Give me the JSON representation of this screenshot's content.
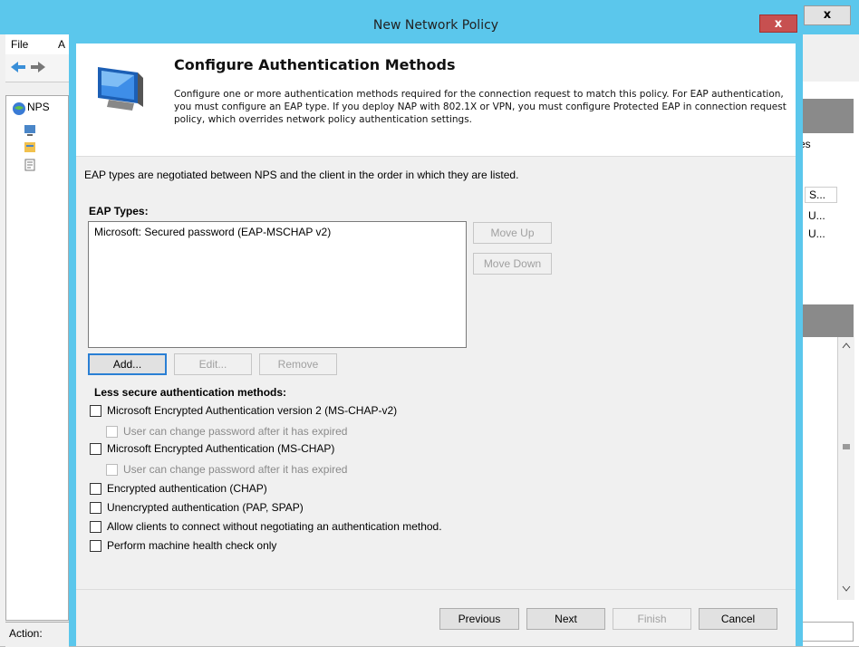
{
  "background_window": {
    "menu": [
      "File",
      "A"
    ],
    "tree_root": "NPS",
    "status_label": "Action:",
    "right_pane_text": "es",
    "right_pane_column": "S...",
    "right_pane_rows": [
      "U...",
      "U..."
    ],
    "close_glyph": "x"
  },
  "dialog": {
    "title": "New Network Policy",
    "close_glyph": "x",
    "header": {
      "title": "Configure Authentication Methods",
      "description": "Configure one or more authentication methods required for the connection request to match this policy. For EAP authentication, you must configure an EAP type. If you deploy NAP with 802.1X or VPN, you must configure Protected EAP in connection request policy, which overrides network policy authentication settings."
    },
    "info_text": "EAP types are negotiated between NPS and the client in the order in which they are listed.",
    "eap_types_label": "EAP Types:",
    "eap_types": [
      "Microsoft: Secured password (EAP-MSCHAP v2)"
    ],
    "buttons": {
      "move_up": "Move Up",
      "move_down": "Move Down",
      "add": "Add...",
      "edit": "Edit...",
      "remove": "Remove"
    },
    "less_secure_label": "Less secure authentication methods:",
    "options": [
      {
        "label": "Microsoft Encrypted Authentication version 2 (MS-CHAP-v2)",
        "checked": false,
        "enabled": true,
        "indent": false
      },
      {
        "label": "User can change password after it has expired",
        "checked": false,
        "enabled": false,
        "indent": true
      },
      {
        "label": "Microsoft Encrypted Authentication (MS-CHAP)",
        "checked": false,
        "enabled": true,
        "indent": false
      },
      {
        "label": "User can change password after it has expired",
        "checked": false,
        "enabled": false,
        "indent": true
      },
      {
        "label": "Encrypted authentication (CHAP)",
        "checked": false,
        "enabled": true,
        "indent": false
      },
      {
        "label": "Unencrypted authentication (PAP, SPAP)",
        "checked": false,
        "enabled": true,
        "indent": false
      },
      {
        "label": "Allow clients to connect without negotiating an authentication method.",
        "checked": false,
        "enabled": true,
        "indent": false
      },
      {
        "label": "Perform machine health check only",
        "checked": false,
        "enabled": true,
        "indent": false
      }
    ],
    "footer": {
      "previous": "Previous",
      "next": "Next",
      "finish": "Finish",
      "cancel": "Cancel"
    }
  },
  "colors": {
    "titlebar": "#5bc7ec",
    "close_button": "#c75050"
  }
}
